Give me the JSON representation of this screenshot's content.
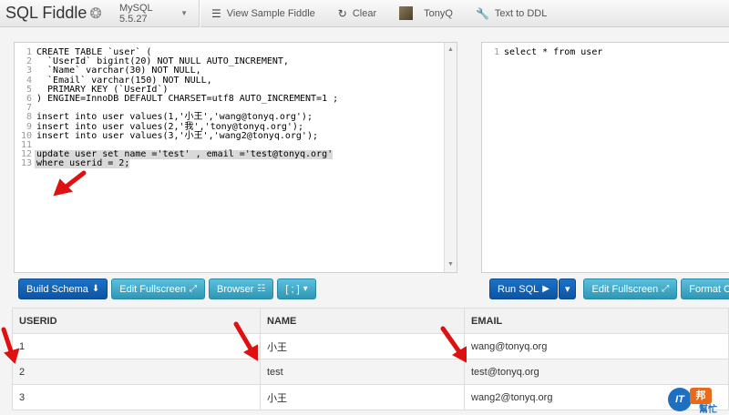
{
  "app": {
    "title": "SQL Fiddle",
    "db_version": "MySQL 5.5.27",
    "nav": {
      "view_sample": "View Sample Fiddle",
      "clear": "Clear",
      "user": "TonyQ",
      "text_to_ddl": "Text to DDL"
    }
  },
  "schema_editor": {
    "line_numbers": [
      "1",
      "2",
      "3",
      "4",
      "5",
      "6",
      "7",
      "8",
      "9",
      "10",
      "11",
      "12",
      "13"
    ],
    "lines": [
      "CREATE TABLE `user` (",
      "  `UserId` bigint(20) NOT NULL AUTO_INCREMENT,",
      "  `Name` varchar(30) NOT NULL,",
      "  `Email` varchar(150) NOT NULL,",
      "  PRIMARY KEY (`UserId`)",
      ") ENGINE=InnoDB DEFAULT CHARSET=utf8 AUTO_INCREMENT=1 ;",
      "",
      "insert into user values(1,'小王','wang@tonyq.org');",
      "insert into user values(2,'我','tony@tonyq.org');",
      "insert into user values(3,'小王','wang2@tonyq.org');",
      "",
      "update user set name ='test' , email ='test@tonyq.org'",
      "where userid = 2;"
    ],
    "highlighted_lines": [
      12,
      13
    ]
  },
  "query_editor": {
    "line_numbers": [
      "1"
    ],
    "lines": [
      "select * from user"
    ]
  },
  "schema_buttons": {
    "build": "Build Schema",
    "edit_fullscreen": "Edit Fullscreen",
    "browser": "Browser",
    "delimiter": "[ ; ]"
  },
  "query_buttons": {
    "run": "Run SQL",
    "edit_fullscreen": "Edit Fullscreen",
    "format": "Format Co"
  },
  "results": {
    "headers": [
      "USERID",
      "NAME",
      "EMAIL"
    ],
    "rows": [
      [
        "1",
        "小王",
        "wang@tonyq.org"
      ],
      [
        "2",
        "test",
        "test@tonyq.org"
      ],
      [
        "3",
        "小王",
        "wang2@tonyq.org"
      ]
    ]
  },
  "watermark": {
    "badge": "IT",
    "mark": "邦",
    "sub": "幫忙"
  },
  "colors": {
    "primary_button": "#0e54a3",
    "info_button": "#2f96b4",
    "annotation_arrow": "#e01010"
  }
}
